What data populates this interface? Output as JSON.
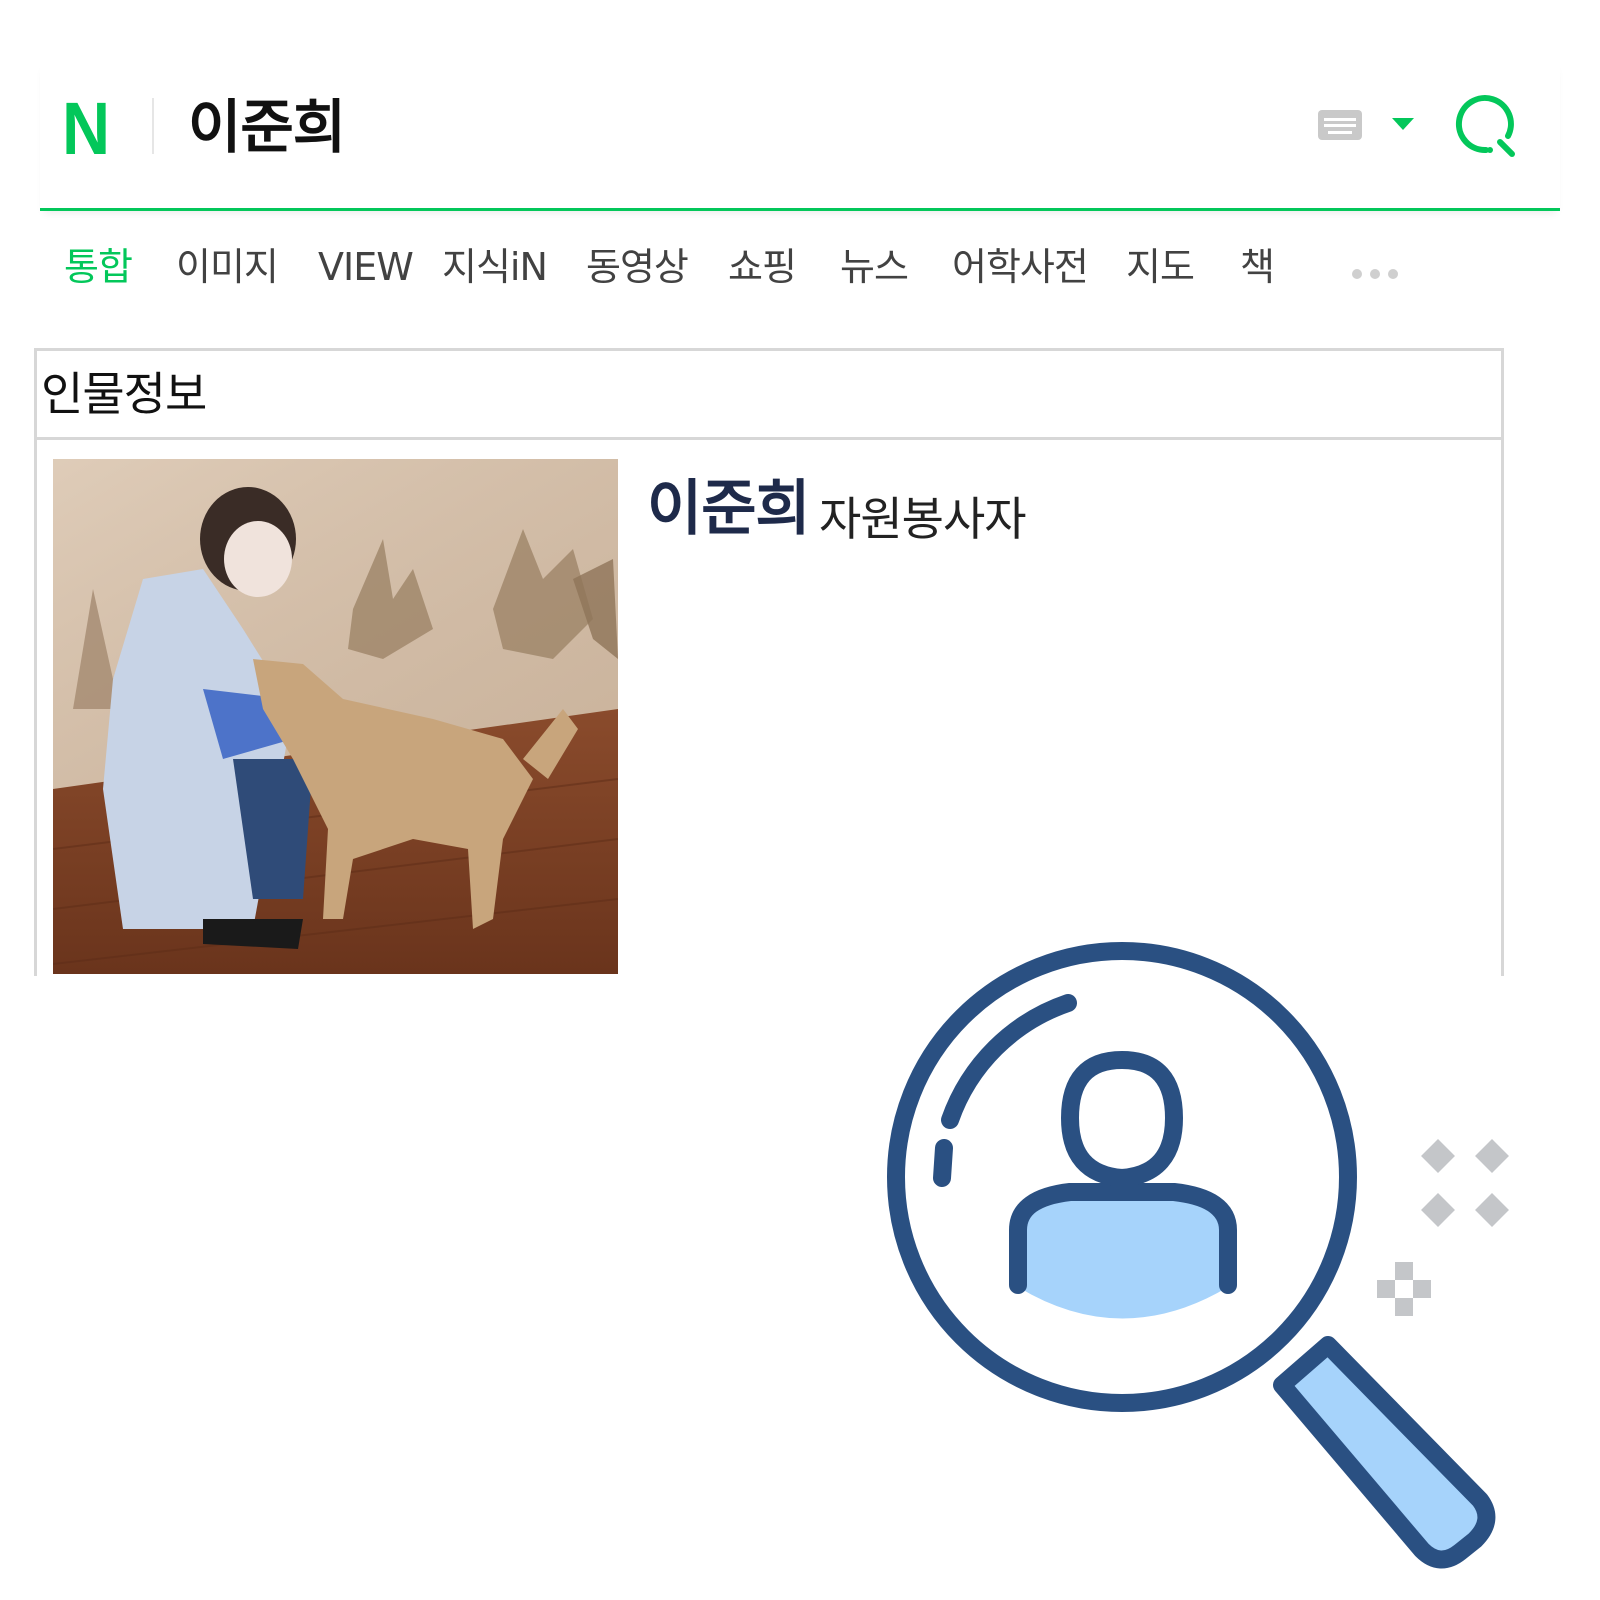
{
  "header": {
    "logo": "N",
    "query": "이준희"
  },
  "icons": {
    "logo": "naver-n-logo",
    "keyboard": "keyboard-icon",
    "dropdown": "caret-down-icon",
    "search": "search-icon",
    "more": "more-dots-icon",
    "illustration": "person-search-magnifier-icon"
  },
  "tabs": [
    {
      "label": "통합",
      "active": true
    },
    {
      "label": "이미지"
    },
    {
      "label": "VIEW"
    },
    {
      "label": "지식iN"
    },
    {
      "label": "동영상"
    },
    {
      "label": "쇼핑"
    },
    {
      "label": "뉴스"
    },
    {
      "label": "어학사전"
    },
    {
      "label": "지도"
    },
    {
      "label": "책"
    }
  ],
  "person_info": {
    "section_title": "인물정보",
    "name": "이준희",
    "role": "자원봉사자"
  },
  "colors": {
    "brand_green": "#03c75a",
    "name_navy": "#1e2a4a",
    "illustration_navy": "#2a5082",
    "illustration_light_blue": "#a6d3fb",
    "decor_gray": "#c4c6c9"
  }
}
